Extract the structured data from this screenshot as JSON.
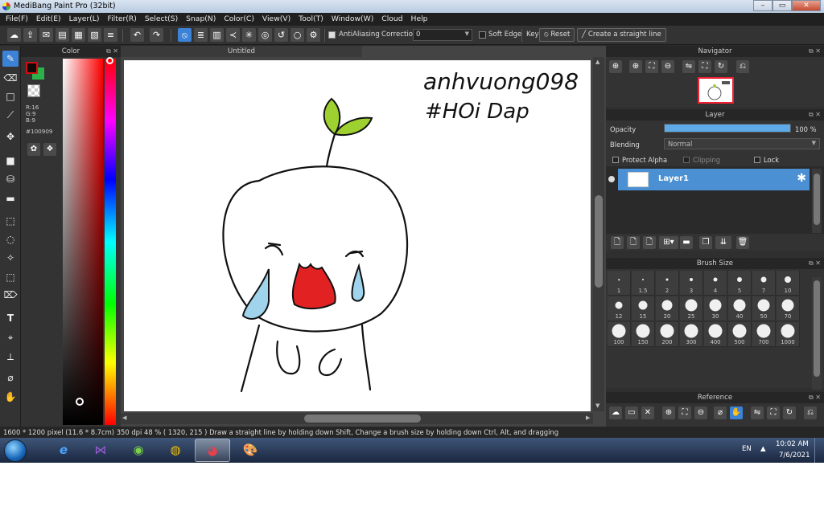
{
  "window": {
    "title": "MediBang Paint Pro (32bit)",
    "controls": {
      "minimize": "–",
      "maximize": "▭",
      "close": "✕"
    }
  },
  "menu": [
    "File(F)",
    "Edit(E)",
    "Layer(L)",
    "Filter(R)",
    "Select(S)",
    "Snap(N)",
    "Color(C)",
    "View(V)",
    "Tool(T)",
    "Window(W)",
    "Cloud",
    "Help"
  ],
  "toolbar": {
    "antialiasing_label": "AntiAliasing",
    "correction_label": "Correction",
    "correction_value": "0",
    "soft_edge_label": "Soft Edge",
    "key_label": "Key",
    "reset_label": "Reset",
    "straight_line_label": "Create a straight line"
  },
  "color_panel": {
    "title": "Color",
    "r": "R:16",
    "g": "G:9",
    "b": "B:9",
    "hex": "#100909",
    "foreground_color": "#100909",
    "background_color": "#2bb24a",
    "foreground_border": "#d01010"
  },
  "canvas": {
    "tab_title": "Untitled",
    "handwriting_line1": "anhvuong098",
    "handwriting_line2": "#HOi Dap",
    "colors": {
      "leaf": "#9ed12f",
      "mouth": "#e22222",
      "tears": "#9fd4ec"
    }
  },
  "navigator": {
    "title": "Navigator"
  },
  "layer_panel": {
    "title": "Layer",
    "opacity_label": "Opacity",
    "opacity_value": "100 %",
    "opacity_fraction": 1.0,
    "blending_label": "Blending",
    "blending_value": "Normal",
    "protect_alpha_label": "Protect Alpha",
    "clipping_label": "Clipping",
    "lock_label": "Lock",
    "layers": [
      {
        "name": "Layer1",
        "selected": true
      }
    ]
  },
  "brush_size": {
    "title": "Brush Size",
    "sizes": [
      "1",
      "1.5",
      "2",
      "3",
      "4",
      "5",
      "7",
      "10",
      "12",
      "15",
      "20",
      "25",
      "30",
      "40",
      "50",
      "70",
      "100",
      "150",
      "200",
      "300",
      "400",
      "500",
      "700",
      "1000"
    ]
  },
  "reference": {
    "title": "Reference"
  },
  "status": {
    "text": "1600 * 1200 pixel   (11.6 * 8.7cm)  350 dpi   48 %   ( 1320, 215 )   Draw a straight line by holding down Shift, Change a brush size by holding down Ctrl, Alt, and dragging"
  },
  "taskbar": {
    "language": "EN",
    "time": "10:02 AM",
    "date": "7/6/2021"
  }
}
